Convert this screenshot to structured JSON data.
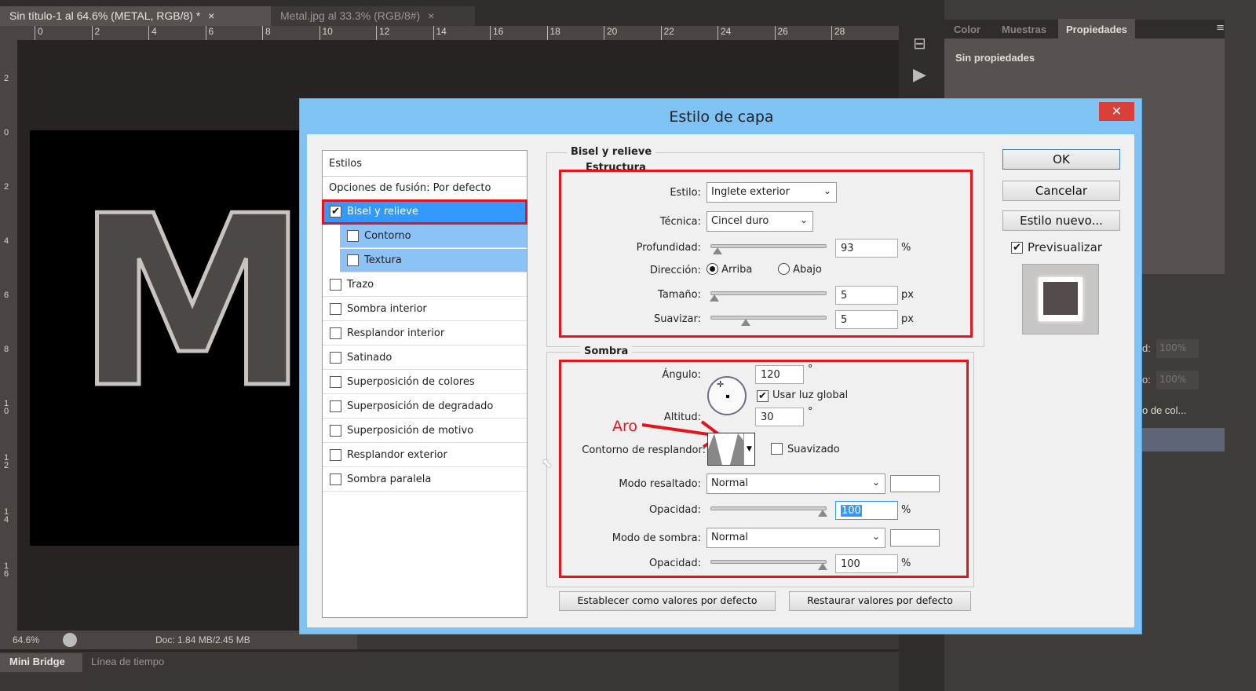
{
  "doc_tabs": [
    {
      "label": "Sin título-1 al 64.6% (METAL, RGB/8) *",
      "active": true
    },
    {
      "label": "Metal.jpg al 33.3% (RGB/8#)",
      "active": false
    }
  ],
  "ruler_h": [
    "0",
    "2",
    "4",
    "6",
    "8",
    "10",
    "12",
    "14",
    "16",
    "18",
    "20",
    "22",
    "24",
    "26",
    "28"
  ],
  "ruler_v": [
    "2",
    "0",
    "2",
    "4",
    "6",
    "8",
    "1 0",
    "1 2",
    "1 4",
    "1 6"
  ],
  "canvas_text": "ME",
  "status": {
    "zoom": "64.6%",
    "doc": "Doc: 1.84 MB/2.45 MB"
  },
  "bottom_tabs": [
    "Mini Bridge",
    "Línea de tiempo"
  ],
  "right_panel": {
    "tabs": [
      "Color",
      "Muestras",
      "Propiedades"
    ],
    "active_tab": "Propiedades",
    "content": "Sin propiedades",
    "layers_fill_label": "d:",
    "layers_fill_value": "100%",
    "layers_opacity_label": "o:",
    "layers_opacity_value": "100%",
    "layer_row": "o de col..."
  },
  "dialog": {
    "title": "Estilo de capa",
    "styles_header": "Estilos",
    "blending": "Opciones de fusión: Por defecto",
    "styles": [
      {
        "label": "Bisel y relieve",
        "checked": true,
        "selected": true
      },
      {
        "label": "Contorno",
        "checked": false,
        "sub": true
      },
      {
        "label": "Textura",
        "checked": false,
        "sub": true
      },
      {
        "label": "Trazo",
        "checked": false
      },
      {
        "label": "Sombra interior",
        "checked": false
      },
      {
        "label": "Resplandor interior",
        "checked": false
      },
      {
        "label": "Satinado",
        "checked": false
      },
      {
        "label": "Superposición de colores",
        "checked": false
      },
      {
        "label": "Superposición de degradado",
        "checked": false
      },
      {
        "label": "Superposición de motivo",
        "checked": false
      },
      {
        "label": "Resplandor exterior",
        "checked": false
      },
      {
        "label": "Sombra paralela",
        "checked": false
      }
    ],
    "bevel": {
      "title": "Bisel y relieve",
      "structure": "Estructura",
      "estilo_label": "Estilo:",
      "estilo": "Inglete exterior",
      "tecnica_label": "Técnica:",
      "tecnica": "Cincel duro",
      "profundidad_label": "Profundidad:",
      "profundidad": "93",
      "profundidad_unit": "%",
      "direccion_label": "Dirección:",
      "dir_up": "Arriba",
      "dir_down": "Abajo",
      "direction": "Arriba",
      "tamano_label": "Tamaño:",
      "tamano": "5",
      "tamano_unit": "px",
      "suavizar_label": "Suavizar:",
      "suavizar": "5",
      "suavizar_unit": "px"
    },
    "shading": {
      "title": "Sombra",
      "angulo_label": "Ángulo:",
      "angulo": "120",
      "deg": "°",
      "global_light": "Usar luz global",
      "global_checked": true,
      "altitud_label": "Altitud:",
      "altitud": "30",
      "annotation": "Aro",
      "contour_label": "Contorno de resplandor:",
      "suavizado": "Suavizado",
      "highlight_mode_label": "Modo resaltado:",
      "highlight_mode": "Normal",
      "highlight_color": "#ffffff",
      "opacity_label": "Opacidad:",
      "highlight_opacity": "100",
      "pct": "%",
      "shadow_mode_label": "Modo de sombra:",
      "shadow_mode": "Normal",
      "shadow_color": "#ffffff",
      "shadow_opacity": "100"
    },
    "set_default": "Establecer como valores por defecto",
    "reset_default": "Restaurar valores por defecto",
    "ok": "OK",
    "cancel": "Cancelar",
    "new_style": "Estilo nuevo...",
    "preview": "Previsualizar",
    "preview_checked": true
  },
  "colors": {
    "accent_red": "#e3141c",
    "selected_blue": "#3399ff",
    "titlebar": "#7fc3f5"
  }
}
